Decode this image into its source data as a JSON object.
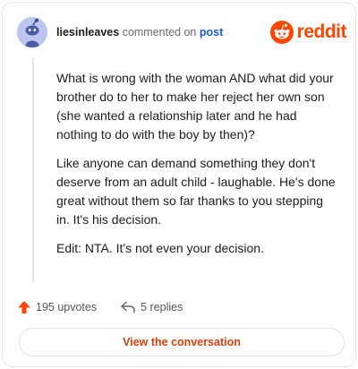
{
  "header": {
    "username": "liesinleaves",
    "action_text": "commented on",
    "post_link": "post",
    "brand_name": "reddit"
  },
  "comment": {
    "paragraphs": [
      "What is wrong with the woman AND what did your brother do to her to make her reject her own son (she wanted a relationship later and he had nothing to do with the boy by then)?",
      "Like anyone can demand something they don't deserve from an adult child - laughable. He's done great without them so far thanks to you stepping in. It's his decision.",
      "Edit: NTA. It's not even your decision."
    ]
  },
  "footer": {
    "upvotes_label": "195 upvotes",
    "replies_label": "5 replies"
  },
  "cta": {
    "label": "View the conversation"
  },
  "colors": {
    "brand": "#ff4500",
    "link": "#1a5cd6",
    "avatar_bg": "#bcc6f0"
  },
  "icons": [
    "avatar-snoo-icon",
    "reddit-logo-icon",
    "upvote-arrow-icon",
    "reply-arrow-icon"
  ]
}
